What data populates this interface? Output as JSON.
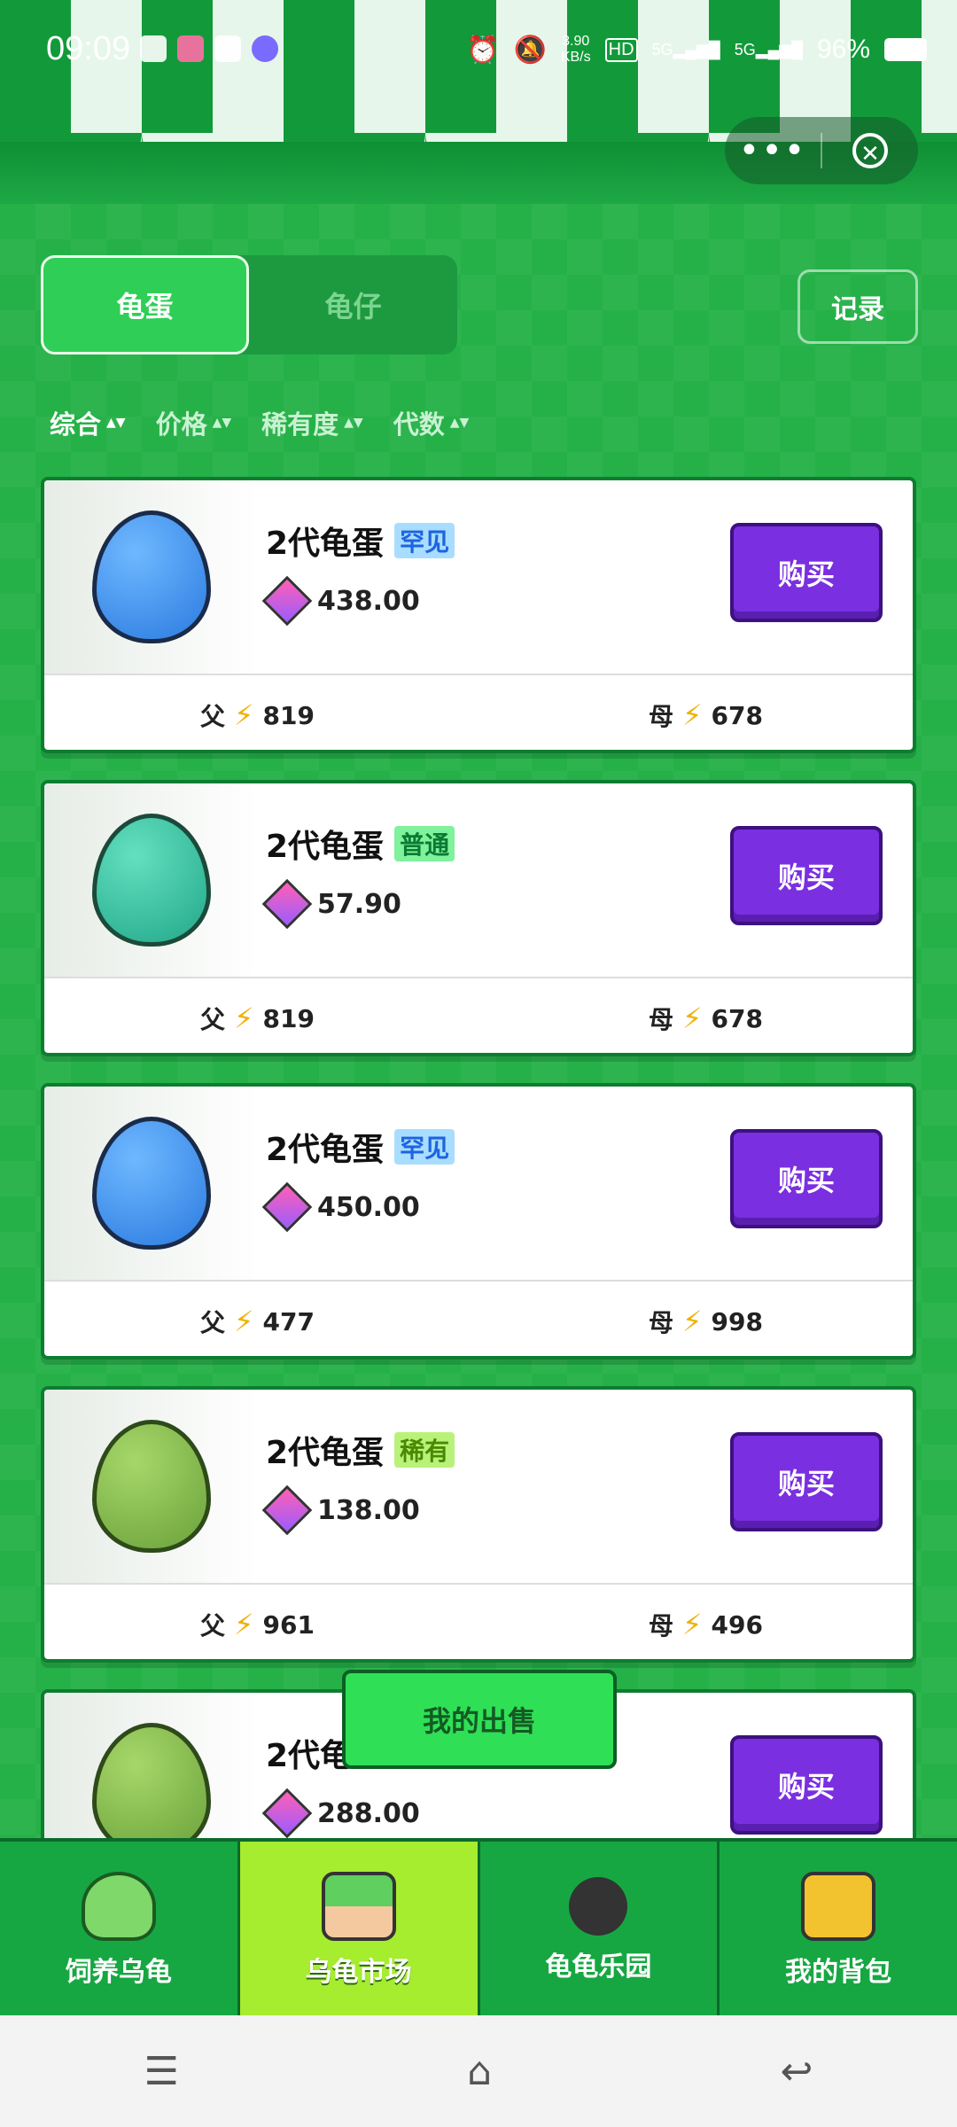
{
  "status": {
    "time": "09:09",
    "net_speed": "3.90\nKB/s",
    "battery": "96%",
    "sig1": "5G",
    "sig2": "5G",
    "hd": "HD"
  },
  "tabs": [
    {
      "label": "龟蛋",
      "active": true
    },
    {
      "label": "龟仔",
      "active": false
    }
  ],
  "record_label": "记录",
  "sorts": [
    {
      "label": "综合",
      "active": true
    },
    {
      "label": "价格"
    },
    {
      "label": "稀有度"
    },
    {
      "label": "代数"
    }
  ],
  "cards": [
    {
      "name": "2代龟蛋",
      "rarity": "罕见",
      "price": "438.00",
      "buy": "购买",
      "father_label": "父",
      "father": "819",
      "mother_label": "母",
      "mother": "678",
      "egg": "blue",
      "rar_style": "blue"
    },
    {
      "name": "2代龟蛋",
      "rarity": "普通",
      "price": "57.90",
      "buy": "购买",
      "father_label": "父",
      "father": "819",
      "mother_label": "母",
      "mother": "678",
      "egg": "teal",
      "rar_style": "green"
    },
    {
      "name": "2代龟蛋",
      "rarity": "罕见",
      "price": "450.00",
      "buy": "购买",
      "father_label": "父",
      "father": "477",
      "mother_label": "母",
      "mother": "998",
      "egg": "blue",
      "rar_style": "blue"
    },
    {
      "name": "2代龟蛋",
      "rarity": "稀有",
      "price": "138.00",
      "buy": "购买",
      "father_label": "父",
      "father": "961",
      "mother_label": "母",
      "mother": "496",
      "egg": "green",
      "rar_style": "lime"
    },
    {
      "name": "2代龟",
      "rarity": "",
      "price": "288.00",
      "buy": "购买",
      "father_label": "",
      "father": "",
      "mother_label": "",
      "mother": "",
      "egg": "green",
      "rar_style": "lime"
    }
  ],
  "my_sale": "我的出售",
  "nav": [
    {
      "label": "饲养乌龟"
    },
    {
      "label": "乌龟市场",
      "active": true
    },
    {
      "label": "龟龟乐园"
    },
    {
      "label": "我的背包"
    }
  ],
  "colors": {
    "primary_green": "#27b24c",
    "buy_purple": "#7a2fe0",
    "nav_active": "#a6ec2f"
  }
}
